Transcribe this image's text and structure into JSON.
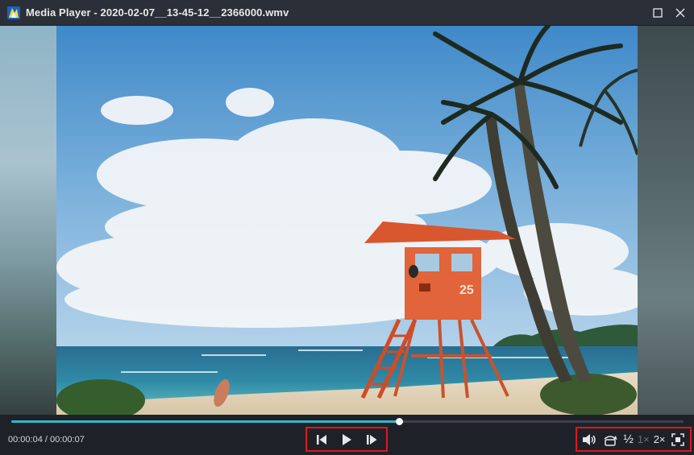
{
  "window": {
    "title": "Media Player - 2020-02-07__13-45-12__2366000.wmv"
  },
  "icons": {
    "app": "media-player-logo-icon",
    "maximize": "maximize-icon",
    "close": "close-icon",
    "previous": "skip-previous-icon",
    "play": "play-icon",
    "next": "skip-next-icon",
    "volume": "volume-icon",
    "rotate": "rotate-icon",
    "fullscreen": "fullscreen-icon"
  },
  "playback": {
    "time_display": "00:00:04 / 00:00:07",
    "progress": 0.577
  },
  "speed_options": {
    "half": "½",
    "normal": "1×",
    "double": "2×"
  },
  "colors": {
    "accent": "#2fb9c8",
    "highlight_box": "#e0161f",
    "titlebar": "#2b3038",
    "controls_bg": "#1e2228"
  }
}
